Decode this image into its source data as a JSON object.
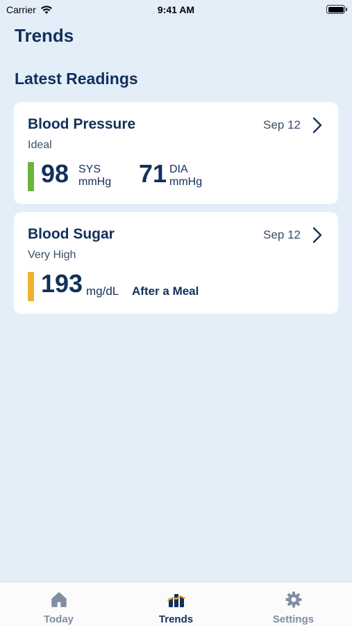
{
  "status_bar": {
    "carrier": "Carrier",
    "time": "9:41 AM"
  },
  "page_title": "Trends",
  "section_title": "Latest Readings",
  "cards": {
    "blood_pressure": {
      "title": "Blood Pressure",
      "date": "Sep 12",
      "status": "Ideal",
      "indicator_color": "#6cb33f",
      "systolic_value": "98",
      "systolic_label": "SYS",
      "systolic_unit": "mmHg",
      "diastolic_value": "71",
      "diastolic_label": "DIA",
      "diastolic_unit": "mmHg"
    },
    "blood_sugar": {
      "title": "Blood Sugar",
      "date": "Sep 12",
      "status": "Very High",
      "indicator_color": "#f0b22e",
      "value": "193",
      "unit": "mg/dL",
      "context": "After a Meal"
    }
  },
  "tabs": [
    {
      "label": "Today",
      "icon": "home-icon",
      "active": false
    },
    {
      "label": "Trends",
      "icon": "trends-icon",
      "active": true
    },
    {
      "label": "Settings",
      "icon": "gear-icon",
      "active": false
    }
  ],
  "colors": {
    "background": "#e3eef9",
    "text_primary": "#12305a",
    "tab_inactive": "#7f8ea3",
    "accent_chart": "#f0b22e"
  }
}
